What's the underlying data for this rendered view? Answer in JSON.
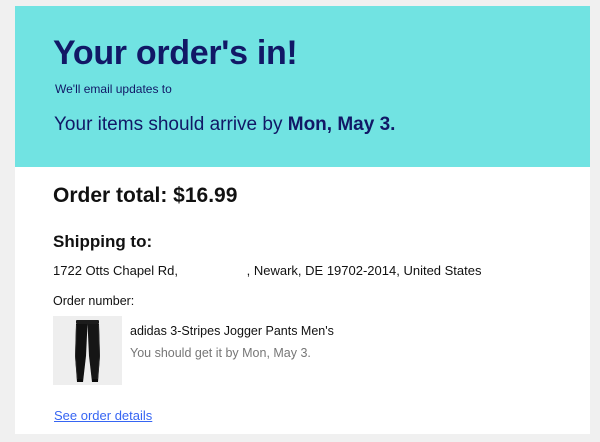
{
  "hero": {
    "title": "Your order's in!",
    "email_text": "We'll email updates to",
    "arrive_prefix": "Your items should arrive by ",
    "arrive_date": "Mon, May 3."
  },
  "order": {
    "total_text": "Order total: $16.99",
    "shipping_label": "Shipping to:",
    "address": "1722 Otts Chapel Rd,                   , Newark, DE 19702-2014, United States",
    "order_number_label": "Order number:"
  },
  "item": {
    "image_icon": "jogger-pants-thumbnail",
    "title": "adidas 3-Stripes Jogger Pants Men's",
    "eta": "You should get it by Mon, May 3."
  },
  "links": {
    "see_details": "See order details"
  },
  "colors": {
    "hero_bg": "#71e3e2",
    "hero_text": "#111866",
    "link": "#3665f3",
    "muted_text": "#767676"
  }
}
